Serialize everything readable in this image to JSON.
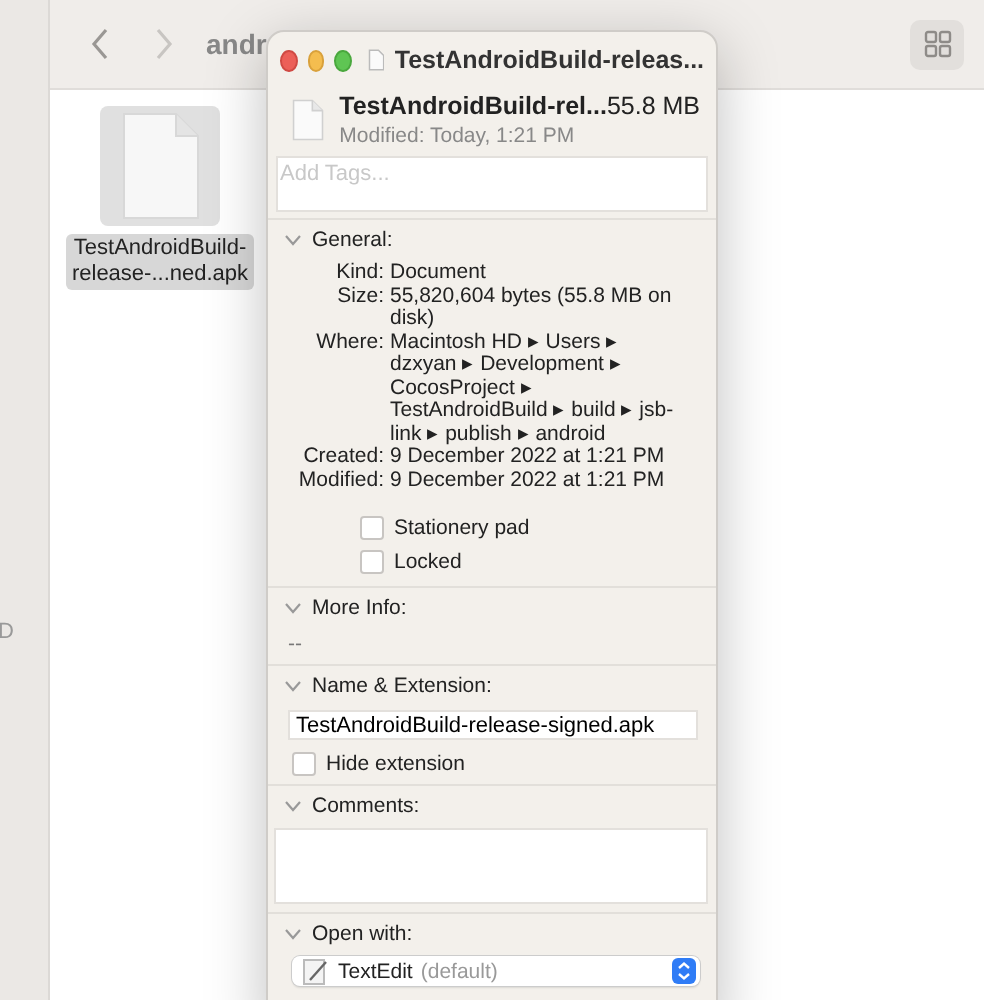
{
  "finder": {
    "title": "andr",
    "sidebar_text": "D",
    "file": {
      "name": "TestAndroidBuild-\nrelease-...ned.apk",
      "selected": true
    }
  },
  "info_window": {
    "title": "TestAndroidBuild-releas...",
    "file_name": "TestAndroidBuild-rel...",
    "size": "55.8 MB",
    "modified": "Modified: Today, 1:21 PM",
    "tags": {
      "placeholder": "Add Tags..."
    },
    "sections": [
      {
        "kind": "general",
        "title": "General:",
        "expanded": true,
        "rows": [
          {
            "label": "Kind:",
            "value": "Document"
          },
          {
            "label": "Size:",
            "value": "55,820,604 bytes (55.8 MB on disk)"
          },
          {
            "label": "Where:",
            "value": "Macintosh HD ▸ Users ▸ dzxyan ▸ Development ▸ CocosProject ▸ TestAndroidBuild ▸ build ▸ jsb-link ▸ publish ▸ android"
          },
          {
            "label": "Created:",
            "value": "9 December 2022 at 1:21 PM"
          },
          {
            "label": "Modified:",
            "value": "9 December 2022 at 1:21 PM"
          }
        ],
        "checkboxes": [
          {
            "label": "Stationery pad",
            "checked": false
          },
          {
            "label": "Locked",
            "checked": false
          }
        ]
      },
      {
        "kind": "text",
        "title": "More Info:",
        "expanded": true,
        "text": "--"
      },
      {
        "kind": "name",
        "title": "Name & Extension:",
        "expanded": true,
        "value": "TestAndroidBuild-release-signed.apk",
        "checkboxes": [
          {
            "label": "Hide extension",
            "checked": false
          }
        ]
      },
      {
        "kind": "comments",
        "title": "Comments:",
        "expanded": true
      },
      {
        "kind": "open_with",
        "title": "Open with:",
        "expanded": true,
        "app": "TextEdit",
        "note": "(default)"
      }
    ]
  }
}
